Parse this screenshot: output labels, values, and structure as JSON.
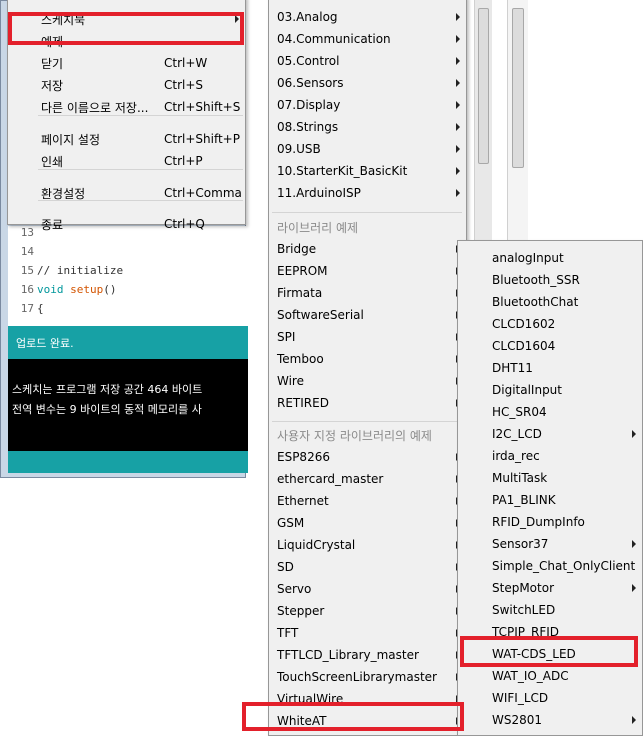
{
  "file_menu": {
    "items": [
      {
        "label": "스케치북",
        "shortcut": "",
        "arrow": true
      },
      {
        "label": "예제",
        "shortcut": "",
        "arrow": false
      },
      {
        "label": "닫기",
        "shortcut": "Ctrl+W",
        "arrow": false
      },
      {
        "label": "저장",
        "shortcut": "Ctrl+S",
        "arrow": false
      },
      {
        "label": "다른 이름으로 저장...",
        "shortcut": "Ctrl+Shift+S",
        "arrow": false
      },
      {
        "label": "페이지 설정",
        "shortcut": "Ctrl+Shift+P",
        "arrow": false
      },
      {
        "label": "인쇄",
        "shortcut": "Ctrl+P",
        "arrow": false
      },
      {
        "label": "환경설정",
        "shortcut": "Ctrl+Comma",
        "arrow": false
      },
      {
        "label": "종료",
        "shortcut": "Ctrl+Q",
        "arrow": false
      }
    ]
  },
  "editor": {
    "lines": [
      {
        "num": "13",
        "code": ""
      },
      {
        "num": "14",
        "code": ""
      },
      {
        "num": "15",
        "code": "// initialize"
      },
      {
        "num": "16",
        "code_kw": "void",
        "code_fn": "setup",
        "code_rest": "()"
      },
      {
        "num": "17",
        "code": "{"
      }
    ]
  },
  "status": {
    "text": "업로드 완료."
  },
  "console": {
    "lines": [
      "스케치는 프로그램 저장 공간 464 바이트",
      "전역 변수는 9 바이트의 동적 메모리를 사"
    ]
  },
  "examples_menu": {
    "builtin": [
      "03.Analog",
      "04.Communication",
      "05.Control",
      "06.Sensors",
      "07.Display",
      "08.Strings",
      "09.USB",
      "10.StarterKit_BasicKit",
      "11.ArduinoISP"
    ],
    "library_header": "라이브러리 예제",
    "library": [
      "Bridge",
      "EEPROM",
      "Firmata",
      "SoftwareSerial",
      "SPI",
      "Temboo",
      "Wire",
      "RETIRED"
    ],
    "custom_header": "사용자 지정 라이브러리의 예제",
    "custom": [
      "ESP8266",
      "ethercard_master",
      "Ethernet",
      "GSM",
      "LiquidCrystal",
      "SD",
      "Servo",
      "Stepper",
      "TFT",
      "TFTLCD_Library_master",
      "TouchScreenLibrarymaster",
      "VirtualWire",
      "WhiteAT"
    ]
  },
  "whiteat_menu": {
    "items": [
      {
        "label": "analogInput",
        "arrow": false
      },
      {
        "label": "Bluetooth_SSR",
        "arrow": false
      },
      {
        "label": "BluetoothChat",
        "arrow": false
      },
      {
        "label": "CLCD1602",
        "arrow": false
      },
      {
        "label": "CLCD1604",
        "arrow": false
      },
      {
        "label": "DHT11",
        "arrow": false
      },
      {
        "label": "DigitalInput",
        "arrow": false
      },
      {
        "label": "HC_SR04",
        "arrow": false
      },
      {
        "label": "I2C_LCD",
        "arrow": true
      },
      {
        "label": "irda_rec",
        "arrow": false
      },
      {
        "label": "MultiTask",
        "arrow": false
      },
      {
        "label": "PA1_BLINK",
        "arrow": false
      },
      {
        "label": "RFID_DumpInfo",
        "arrow": false
      },
      {
        "label": "Sensor37",
        "arrow": true
      },
      {
        "label": "Simple_Chat_OnlyClient",
        "arrow": false
      },
      {
        "label": "StepMotor",
        "arrow": true
      },
      {
        "label": "SwitchLED",
        "arrow": false
      },
      {
        "label": "TCPIP_RFID",
        "arrow": false
      },
      {
        "label": "WAT-CDS_LED",
        "arrow": false
      },
      {
        "label": "WAT_IO_ADC",
        "arrow": false
      },
      {
        "label": "WIFI_LCD",
        "arrow": false
      },
      {
        "label": "WS2801",
        "arrow": true
      }
    ]
  },
  "colors": {
    "highlight": "#e3202b",
    "teal": "#17a1a5",
    "menu_bg": "#f0f0f0"
  }
}
